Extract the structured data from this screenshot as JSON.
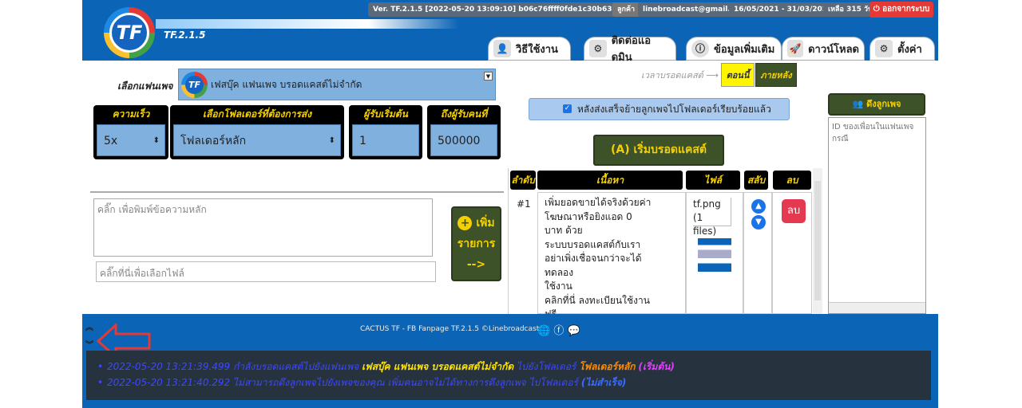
{
  "header": {
    "logo_text": "TF",
    "version_label": "TF.2.1.5",
    "version_info": "Ver. TF.2.1.5  [2022-05-20 13:09:10] b06c76ffff0fde1c30b63d5083aa19811",
    "user_label": "ลูกค้า",
    "email": "linebroadcast@gmail.com",
    "period": "16/05/2021 - 31/03/2023",
    "remaining": "เหลือ 315 วัน",
    "logout_label": "ออกจากระบบ",
    "tabs": [
      {
        "label": "วิธีใช้งาน",
        "icon": "user-desk-icon"
      },
      {
        "label": "ติดต่อแอดมิน",
        "icon": "admin-icon"
      },
      {
        "label": "ข้อมูลเพิ่มเติม",
        "icon": "info-icon"
      },
      {
        "label": "ดาวน์โหลด",
        "icon": "rocket-icon"
      },
      {
        "label": "ตั้งค่า",
        "icon": "settings-icon"
      }
    ]
  },
  "form": {
    "fanpage_label": "เลือกแฟนเพจ",
    "fanpage_value": "เฟสบุ๊ค แฟนเพจ บรอดแคสต์ไม่จำกัด",
    "speed_label": "ความเร็ว",
    "speed_value": "5x",
    "folder_label": "เลือกโฟลเดอร์ที่ต้องการส่ง",
    "folder_value": "โฟลเดอร์หลัก",
    "start_label": "ผู้รับเริ่มต้น",
    "start_value": "1",
    "end_label": "ถึงผู้รับคนที่",
    "end_value": "500000",
    "message_placeholder": "คลิ๊ก เพื่อพิมพ์ข้อความหลัก",
    "file_placeholder": "คลิ๊กที่นี่เพื่อเลือกไฟล์",
    "add_button": {
      "line1": "เพิ่ม",
      "line2": "รายการ",
      "line3": "-->"
    }
  },
  "broadcast": {
    "time_label": "เวลาบรอดแคสต์ ⟶",
    "now_label": "ตอนนี้",
    "later_label": "ภายหลัง",
    "move_check_label": "หลังส่งเสร็จย้ายลูกเพจไปโฟลเดอร์เรียบร้อยแล้ว",
    "start_label": "เริ่มบรอดแคสต์",
    "start_icon": "(A)"
  },
  "table": {
    "headers": [
      "ลำดับ",
      "เนื้อหา",
      "ไฟล์",
      "สลับ",
      "ลบ"
    ],
    "rows": [
      {
        "index": "#1",
        "content_lines": [
          "เพิ่มยอดขายได้จริงด้วยค่า",
          "โฆษณาหรือยิงแอด 0 บาท ด้วย",
          "ระบบบรอดแคสต์กับเรา",
          "อย่าเพิ่งเชื่อจนกว่าจะได้ทดลอง",
          "ใช้งาน",
          "คลิกที่นี่ ลงทะเบียนใช้งานฟรี"
        ],
        "file_lines": [
          "tf.png (1",
          "files)"
        ],
        "delete_label": "ลบ"
      }
    ]
  },
  "side": {
    "pull_label": "ดึงลูกเพจ",
    "id_placeholder": "ID ของเพื่อนในแฟนเพจ กรณี"
  },
  "footer": {
    "text": "CACTUS TF - FB Fanpage TF.2.1.5 ©Linebroadcast",
    "logs": [
      {
        "time": "2022-05-20 13:21:39.499",
        "msg": "กำลังบรอดแคสต์ไปยังแฟนเพจ",
        "page": "เฟสบุ๊ค แฟนเพจ บรอดแคสต์ไม่จำกัด",
        "mid": "ไปยังโฟลเดอร์",
        "folder": "โฟลเดอร์หลัก",
        "tag": "(เริ่มต้น)"
      },
      {
        "time": "2022-05-20 13:21:40.292",
        "msg": "ไม่สามารถดึงลูกเพจไปยังเพจของคุณ เพิ่มคนอาจไม่ได้ทางการดึงลูกเพจ ไปโฟลเดอร์",
        "tag": "(ไม่สำเร็จ)"
      }
    ]
  }
}
